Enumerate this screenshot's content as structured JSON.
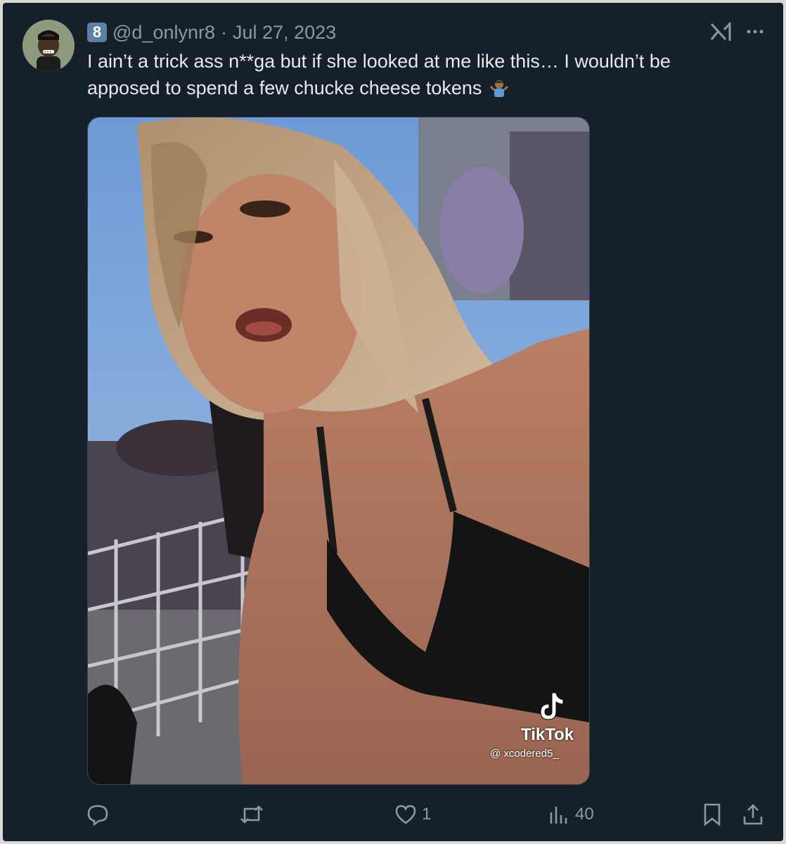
{
  "tweet": {
    "badge": "8",
    "handle": "@d_onlynr8",
    "separator": "·",
    "date": "Jul 27, 2023",
    "text": "I ain’t a trick ass n**ga but if she looked at me like this… I wouldn’t be apposed to spend a few chucke cheese tokens",
    "emoji": "person-shrugging-emoji"
  },
  "media": {
    "watermark_brand": "TikTok",
    "watermark_handle": "@ xcodered5_"
  },
  "actions": {
    "reply_count": "",
    "retweet_count": "",
    "like_count": "1",
    "views_count": "40"
  },
  "colors": {
    "background": "#15202b",
    "text": "#e7e9ea",
    "secondary": "#8b98a5",
    "badge": "#5c7fa3"
  }
}
